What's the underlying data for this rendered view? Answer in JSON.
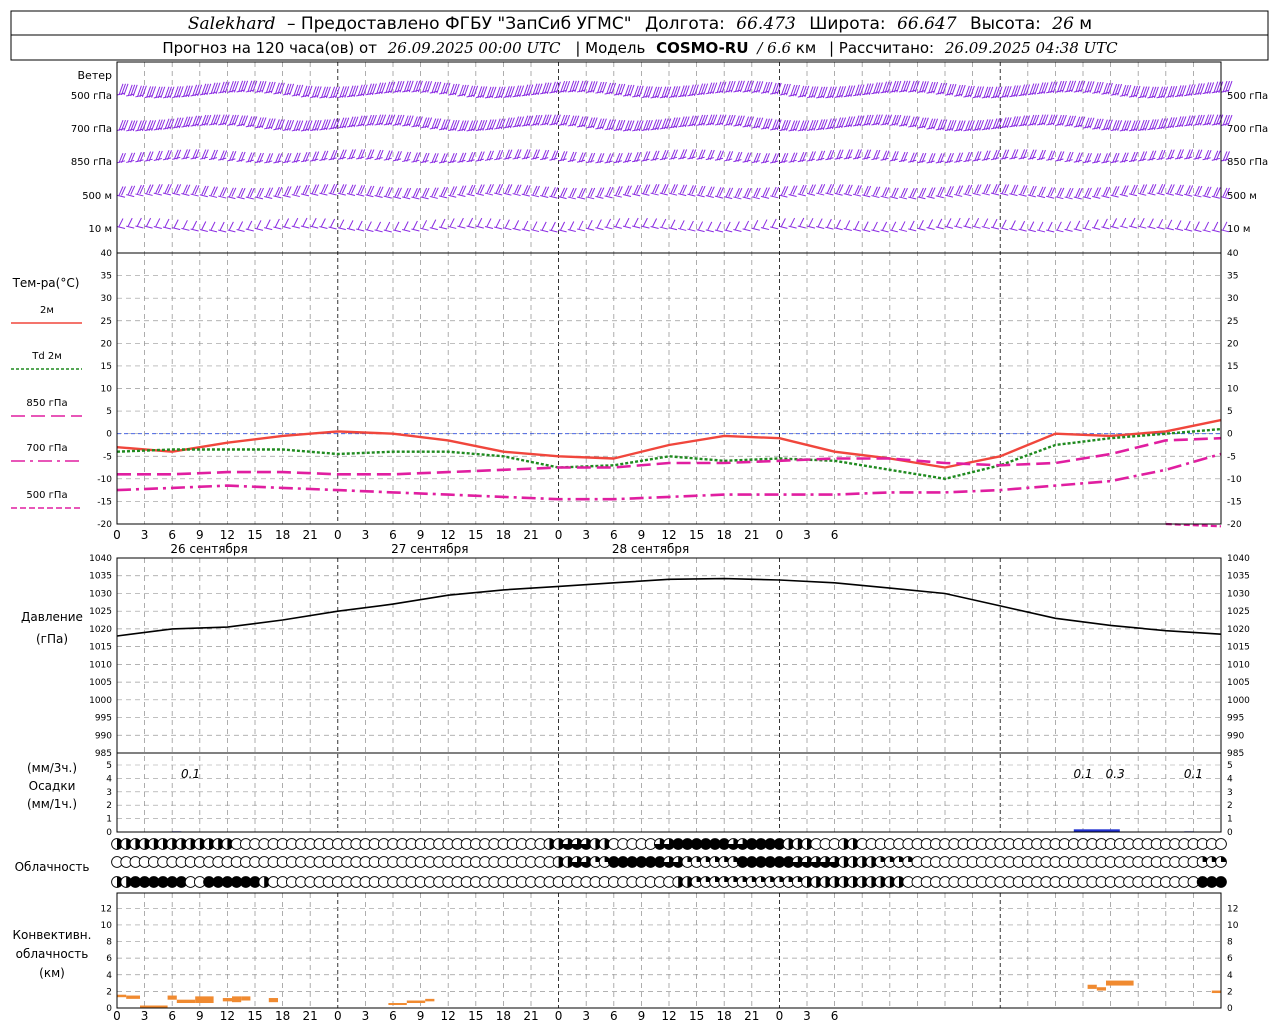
{
  "header": {
    "station": "Salekhard",
    "provided": "– Предоставлено ФГБУ \"ЗапСиб УГМС\"",
    "lon_label": "Долгота:",
    "lon_value": "66.473",
    "lat_label": "Широта:",
    "lat_value": "66.647",
    "alt_label": "Высота:",
    "alt_value": "26",
    "alt_unit": "м",
    "forecast_label": "Прогноз на 120 часа(ов)  от",
    "forecast_from": "26.09.2025 00:00 UTC",
    "model_label": "| Модель",
    "model_name": "COSMO-RU",
    "model_res": "/ 6.6",
    "model_res_unit": "км",
    "calc_label": "| Рассчитано:",
    "calc_value": "26.09.2025 04:38 UTC"
  },
  "colors": {
    "wind": "#8a2be2",
    "t2m": "#f0463c",
    "td2m": "#1f8a1f",
    "t850": "#e01ea0",
    "t700": "#e01ea0",
    "t500": "#e01ea0",
    "pressure": "#000000",
    "precip": "#2030d0",
    "conv": "#f08a30",
    "grid": "#999999"
  },
  "wind": {
    "title": "Ветер",
    "levels": [
      "500 гПа",
      "700 гПа",
      "850 гПа",
      "500 м",
      "10  м"
    ]
  },
  "x_axis": {
    "hour_ticks": [
      "0",
      "3",
      "6",
      "9",
      "12",
      "15",
      "18",
      "21",
      "0",
      "3",
      "6",
      "9",
      "12",
      "15",
      "18",
      "21",
      "0",
      "3",
      "6",
      "9",
      "12",
      "15",
      "18",
      "21",
      "0",
      "3",
      "6"
    ],
    "dates": [
      "26 сентября",
      "27 сентября",
      "28 сентября"
    ]
  },
  "temperature": {
    "title": "Тем-ра(°С)",
    "legend": [
      "2м",
      "Td  2м",
      "850 гПа",
      "700 гПа",
      "500 гПа"
    ],
    "y_ticks": [
      "40",
      "35",
      "30",
      "25",
      "20",
      "15",
      "10",
      "5",
      "0",
      "-5",
      "-10",
      "-15",
      "-20"
    ]
  },
  "pressure": {
    "title": "Давление",
    "unit": "(гПа)",
    "y_ticks": [
      "1040",
      "1035",
      "1030",
      "1025",
      "1020",
      "1015",
      "1010",
      "1005",
      "1000",
      "995",
      "990",
      "985"
    ]
  },
  "precip": {
    "unit_3h": "(мм/3ч.)",
    "title": "Осадки",
    "unit_1h": "(мм/1ч.)",
    "y_ticks": [
      "5",
      "4",
      "3",
      "2",
      "1",
      "0"
    ],
    "labels": [
      {
        "hour": 8,
        "text": "0.1"
      },
      {
        "hour": 105,
        "text": "0.1"
      },
      {
        "hour": 108.5,
        "text": "0.3"
      },
      {
        "hour": 117,
        "text": "0.1"
      }
    ]
  },
  "clouds": {
    "title": "Облачность"
  },
  "convective": {
    "title_1": "Конвективн.",
    "title_2": "облачность",
    "unit": "(км)",
    "y_ticks": [
      "12",
      "10",
      "8",
      "6",
      "4",
      "2",
      "0"
    ]
  },
  "chart_data": [
    {
      "type": "line",
      "title": "",
      "xlabel": "",
      "ylabel": "Тем-ра(°С)",
      "ylim": [
        -20,
        40
      ],
      "x_hours": [
        0,
        6,
        12,
        18,
        24,
        30,
        36,
        42,
        48,
        54,
        60,
        66,
        72,
        78,
        84,
        90,
        96,
        102,
        108,
        114,
        120
      ],
      "series": [
        {
          "name": "2м",
          "values": [
            -3,
            -4,
            -2,
            -0.5,
            0.5,
            0,
            -1.5,
            -4,
            -5,
            -5.5,
            -2.5,
            -0.5,
            -1,
            -4,
            -5.5,
            -7.5,
            -5,
            0,
            -0.5,
            0.5,
            3
          ]
        },
        {
          "name": "Td  2м",
          "values": [
            -4,
            -3.5,
            -3.5,
            -3.5,
            -4.5,
            -4,
            -4,
            -5,
            -7.5,
            -7,
            -5,
            -6,
            -5.5,
            -6,
            -8,
            -10,
            -7,
            -2.5,
            -1,
            0,
            1
          ]
        },
        {
          "name": "850 гПа",
          "values": [
            -9,
            -9,
            -8.5,
            -8.5,
            -9,
            -9,
            -8.5,
            -8,
            -7.5,
            -7.5,
            -6.5,
            -6.5,
            -6,
            -5.5,
            -5.5,
            -6.5,
            -7,
            -6.5,
            -4.5,
            -1.5,
            -1
          ]
        },
        {
          "name": "700 гПа",
          "values": [
            -12.5,
            -12,
            -11.5,
            -12,
            -12.5,
            -13,
            -13.5,
            -14,
            -14.5,
            -14.5,
            -14,
            -13.5,
            -13.5,
            -13.5,
            -13,
            -13,
            -12.5,
            -11.5,
            -10.5,
            -8,
            -4.5
          ]
        },
        {
          "name": "500 гПа",
          "values": [
            null,
            null,
            null,
            null,
            null,
            null,
            null,
            null,
            null,
            null,
            null,
            null,
            null,
            null,
            null,
            null,
            null,
            null,
            null,
            -20,
            -20.5
          ]
        }
      ]
    },
    {
      "type": "line",
      "title": "",
      "xlabel": "",
      "ylabel": "Давление (гПа)",
      "ylim": [
        985,
        1040
      ],
      "x_hours": [
        0,
        6,
        12,
        18,
        24,
        30,
        36,
        42,
        48,
        54,
        60,
        66,
        72,
        78,
        84,
        90,
        96,
        102,
        108,
        114,
        120
      ],
      "series": [
        {
          "name": "",
          "values": [
            1018,
            1020,
            1020.5,
            1022.5,
            1025,
            1027,
            1029.5,
            1031,
            1032,
            1033,
            1034,
            1034.2,
            1033.8,
            1033,
            1031.5,
            1030,
            1026.5,
            1023,
            1021,
            1019.5,
            1018.5
          ]
        }
      ]
    },
    {
      "type": "bar",
      "title": "",
      "xlabel": "",
      "ylabel": "Осадки (мм/1ч.)",
      "ylim": [
        0,
        5
      ],
      "bars": [
        {
          "from": 6,
          "to": 7,
          "value": 0.05
        },
        {
          "from": 104,
          "to": 109,
          "value": 0.2
        },
        {
          "from": 116,
          "to": 117,
          "value": 0.05
        }
      ]
    },
    {
      "type": "table",
      "title": "Облачность",
      "note": "cloud cover fraction per hour, rows top to bottom",
      "rows": [
        {
          "groups": [
            [
              0,
              12,
              0.5
            ],
            [
              13,
              46,
              0
            ],
            [
              47,
              48,
              0.5
            ],
            [
              49,
              51,
              0.75
            ],
            [
              52,
              53,
              0.5
            ],
            [
              54,
              58,
              0
            ],
            [
              59,
              60,
              0.75
            ],
            [
              61,
              66,
              1
            ],
            [
              67,
              68,
              0.75
            ],
            [
              69,
              72,
              1
            ],
            [
              73,
              75,
              0.5
            ],
            [
              76,
              78,
              0
            ],
            [
              79,
              80,
              0.5
            ],
            [
              81,
              120,
              0
            ]
          ]
        },
        {
          "groups": [
            [
              0,
              47,
              0
            ],
            [
              48,
              49,
              0.5
            ],
            [
              50,
              51,
              0.75
            ],
            [
              52,
              53,
              0.25
            ],
            [
              54,
              59,
              1
            ],
            [
              60,
              61,
              0.75
            ],
            [
              62,
              67,
              0.25
            ],
            [
              68,
              73,
              1
            ],
            [
              74,
              78,
              0.75
            ],
            [
              79,
              82,
              0.5
            ],
            [
              83,
              86,
              0.25
            ],
            [
              87,
              117,
              0
            ],
            [
              118,
              120,
              0.25
            ]
          ]
        },
        {
          "groups": [
            [
              0,
              1,
              0.5
            ],
            [
              2,
              7,
              1
            ],
            [
              8,
              9,
              0
            ],
            [
              10,
              15,
              1
            ],
            [
              16,
              16,
              0.5
            ],
            [
              17,
              60,
              0
            ],
            [
              61,
              62,
              0.5
            ],
            [
              63,
              74,
              0.25
            ],
            [
              75,
              85,
              0.5
            ],
            [
              86,
              117,
              0
            ],
            [
              118,
              120,
              1
            ]
          ]
        }
      ]
    },
    {
      "type": "bar",
      "title": "",
      "xlabel": "",
      "ylabel": "Конвективн. облачность (км)",
      "ylim": [
        0,
        13
      ],
      "bars": [
        {
          "from": 0,
          "to": 1,
          "bottom": 1.3,
          "top": 1.6
        },
        {
          "from": 1,
          "to": 2.5,
          "bottom": 1.1,
          "top": 1.5
        },
        {
          "from": 2.5,
          "to": 5.5,
          "bottom": 0.2,
          "top": 0.3
        },
        {
          "from": 5.5,
          "to": 6.5,
          "bottom": 1.0,
          "top": 1.5
        },
        {
          "from": 6.5,
          "to": 8.5,
          "bottom": 0.6,
          "top": 1.0
        },
        {
          "from": 8.5,
          "to": 10.5,
          "bottom": 0.6,
          "top": 1.4
        },
        {
          "from": 11.5,
          "to": 12.5,
          "bottom": 0.8,
          "top": 1.2
        },
        {
          "from": 12.5,
          "to": 13.5,
          "bottom": 0.7,
          "top": 1.4
        },
        {
          "from": 13.5,
          "to": 14.5,
          "bottom": 0.9,
          "top": 1.4
        },
        {
          "from": 16.5,
          "to": 17.5,
          "bottom": 0.7,
          "top": 1.2
        },
        {
          "from": 29.5,
          "to": 31.5,
          "bottom": 0.4,
          "top": 0.6
        },
        {
          "from": 31.5,
          "to": 33.5,
          "bottom": 0.6,
          "top": 0.9
        },
        {
          "from": 33.5,
          "to": 34.5,
          "bottom": 0.8,
          "top": 1.1
        },
        {
          "from": 105.5,
          "to": 106.5,
          "bottom": 2.3,
          "top": 2.8
        },
        {
          "from": 106.5,
          "to": 107.5,
          "bottom": 2.1,
          "top": 2.5
        },
        {
          "from": 107.5,
          "to": 110.5,
          "bottom": 2.7,
          "top": 3.3
        },
        {
          "from": 119,
          "to": 120,
          "bottom": 1.8,
          "top": 2.1
        }
      ]
    }
  ]
}
